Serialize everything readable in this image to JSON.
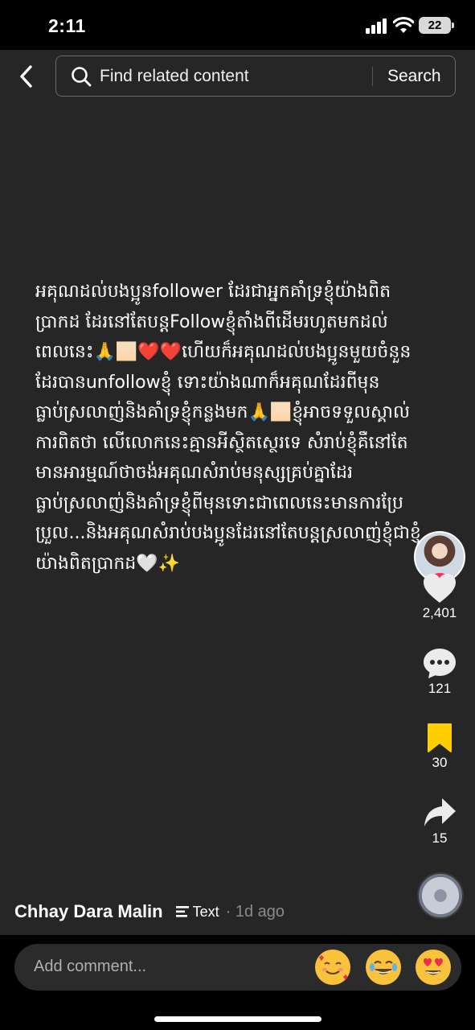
{
  "status_bar": {
    "time": "2:11",
    "battery": "22"
  },
  "header": {
    "search_placeholder": "Find related content",
    "search_button": "Search"
  },
  "post": {
    "caption": "អគុណដល់បងប្អូនfollower ដែរជាអ្នកគាំទ្រខ្ញុំយ៉ាងពិតប្រាកដ ដែរនៅតែបន្តFollowខ្ញុំតាំងពីដើមរហូតមកដល់ពេលនេះ🙏🏻❤️❤️ហើយក៏អគុណដល់បងប្អូនមួយចំនួនដែរបានunfollowខ្ញុំ ទោះយ៉ាងណាក៏អគុណដែរពីមុនធ្លាប់ស្រលាញ់និងគាំទ្រខ្ញុំកន្លងមក🙏🏻ខ្ញុំអាចទទួលស្គាល់ការពិតថា លើលោកនេះគ្មានអីស្ថិតស្ថេរទេ សំរាប់ខ្ញុំគឺនៅតែមានអារម្មណ៍ថាចង់អគុណសំរាប់មនុស្សគ្រប់គ្នាដែរធ្លាប់ស្រលាញ់និងគាំទ្រខ្ញុំពីមុនទោះជាពេលនេះមានការប្រែប្រួល...និងអគុណសំរាប់បងប្អូនដែរនៅតែបន្តស្រលាញ់ខ្ញុំជាខ្ញុំយ៉ាងពិតប្រាកដ🤍✨",
    "author": "Chhay Dara Malin",
    "type_label": "Text",
    "time_ago": "· 1d ago"
  },
  "actions": {
    "likes": "2,401",
    "comments": "121",
    "saves": "30",
    "shares": "15"
  },
  "comment_bar": {
    "placeholder": "Add comment..."
  },
  "colors": {
    "accent": "#fe2c55",
    "save": "#fece00",
    "background": "#262626"
  }
}
